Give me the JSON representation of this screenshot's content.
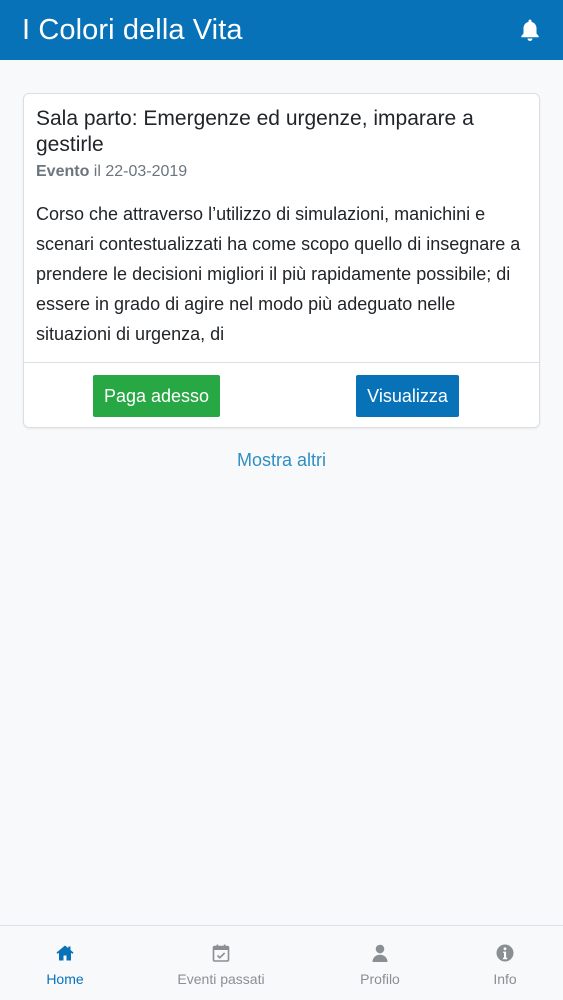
{
  "header": {
    "title": "I Colori della Vita",
    "notification_icon": "bell-icon"
  },
  "event_card": {
    "title": "Sala parto: Emergenze ed urgenze, imparare a gestirle",
    "type": "Evento",
    "date": "il 22-03-2019",
    "description": "Corso che attraverso l’utilizzo di simulazioni, manichini e scenari contestualizzati ha come scopo quello di insegnare a prendere le decisioni migliori il più rapidamente possibile; di essere in grado di agire nel modo più adeguato nelle situazioni di urgenza, di",
    "pay_label": "Paga adesso",
    "view_label": "Visualizza"
  },
  "more_label": "Mostra altri",
  "bottom_nav": {
    "items": [
      {
        "label": "Home",
        "icon": "home-icon",
        "active": true
      },
      {
        "label": "Eventi passati",
        "icon": "calendar-check-icon",
        "active": false
      },
      {
        "label": "Profilo",
        "icon": "user-icon",
        "active": false
      },
      {
        "label": "Info",
        "icon": "info-circle-icon",
        "active": false
      }
    ]
  },
  "colors": {
    "primary": "#0872b9",
    "success": "#28a745",
    "link": "#2f8fc4",
    "inactive_nav": "#8a8f94"
  }
}
